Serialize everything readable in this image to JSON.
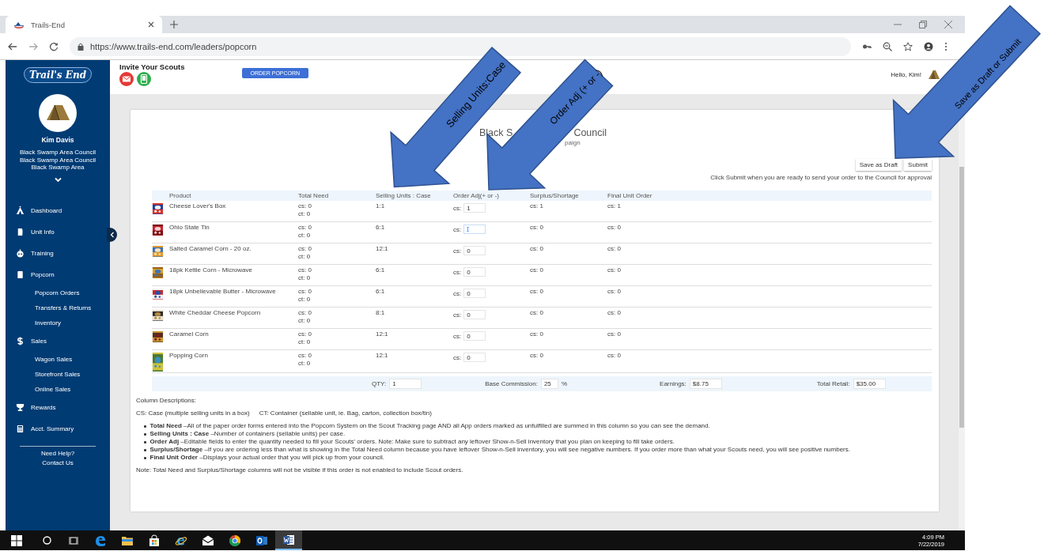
{
  "browser": {
    "tab_title": "Trails-End",
    "url": "https://www.trails-end.com/leaders/popcorn"
  },
  "sidebar": {
    "logo": "Trail's End",
    "user_name": "Kim Davis",
    "affiliations": [
      "Black Swamp Area Council",
      "Black Swamp Area Council",
      "Black Swamp Area"
    ],
    "nav": [
      {
        "label": "Dashboard"
      },
      {
        "label": "Unit Info"
      },
      {
        "label": "Training"
      },
      {
        "label": "Popcorn",
        "children": [
          "Popcorn Orders",
          "Transfers & Returns",
          "Inventory"
        ]
      },
      {
        "label": "Sales",
        "children": [
          "Wagon Sales",
          "Storefront Sales",
          "Online Sales"
        ]
      },
      {
        "label": "Rewards"
      },
      {
        "label": "Acct. Summary"
      }
    ],
    "help": [
      "Need Help?",
      "Contact Us"
    ]
  },
  "header": {
    "invite_title": "Invite Your Scouts",
    "order_button": "ORDER POPCORN",
    "greeting": "Hello, Kim!"
  },
  "order": {
    "title_parts": [
      "Black S",
      "Council"
    ],
    "subtitle_part": "paign",
    "buttons": [
      "Save as Draft",
      "Submit"
    ],
    "hint": "Click Submit when you are ready to send your order to the Council for approval"
  },
  "table": {
    "columns": [
      "Product",
      "Total Need",
      "Selling Units : Case",
      "Order Adj(+ or -)",
      "Surplus/Shortage",
      "Final Unit Order"
    ],
    "rows": [
      {
        "product": "Cheese Lover's Box",
        "total_need": [
          "cs: 0",
          "ct: 0"
        ],
        "selling_units": "1:1",
        "order_adj_label": "cs:",
        "order_adj": "1",
        "focused": false,
        "surplus": "cs: 1",
        "final": "cs: 1"
      },
      {
        "product": "Ohio State Tin",
        "total_need": [
          "cs: 0",
          "ct: 0"
        ],
        "selling_units": "6:1",
        "order_adj_label": "cs:",
        "focused": true,
        "surplus": "cs: 0",
        "final": "cs: 0"
      },
      {
        "product": "Salted Caramel Corn - 20 oz.",
        "total_need": [
          "cs: 0",
          "ct: 0"
        ],
        "selling_units": "12:1",
        "order_adj_label": "cs:",
        "order_adj": "0",
        "focused": false,
        "surplus": "cs: 0",
        "final": "cs: 0"
      },
      {
        "product": "18pk Kettle Corn - Microwave",
        "total_need": [
          "cs: 0",
          "ct: 0"
        ],
        "selling_units": "6:1",
        "order_adj_label": "cs:",
        "order_adj": "0",
        "focused": false,
        "surplus": "cs: 0",
        "final": "cs: 0"
      },
      {
        "product": "18pk Unbelievable Butter - Microwave",
        "total_need": [
          "cs: 0",
          "ct: 0"
        ],
        "selling_units": "6:1",
        "order_adj_label": "cs:",
        "order_adj": "0",
        "focused": false,
        "surplus": "cs: 0",
        "final": "cs: 0"
      },
      {
        "product": "White Cheddar Cheese Popcorn",
        "total_need": [
          "cs: 0",
          "ct: 0"
        ],
        "selling_units": "8:1",
        "order_adj_label": "cs:",
        "order_adj": "0",
        "focused": false,
        "surplus": "cs: 0",
        "final": "cs: 0"
      },
      {
        "product": "Caramel Corn",
        "total_need": [
          "cs: 0",
          "ct: 0"
        ],
        "selling_units": "12:1",
        "order_adj_label": "cs:",
        "order_adj": "0",
        "focused": false,
        "surplus": "cs: 0",
        "final": "cs: 0"
      },
      {
        "product": "Popping Corn",
        "total_need": [
          "cs: 0",
          "ct: 0"
        ],
        "selling_units": "12:1",
        "order_adj_label": "cs:",
        "order_adj": "0",
        "focused": false,
        "surplus": "cs: 0",
        "final": "cs: 0"
      }
    ]
  },
  "totals": [
    {
      "label": "QTY:",
      "value": "1"
    },
    {
      "label": "Base Commission:",
      "value": "25",
      "suffix": "%"
    },
    {
      "label": "Earnings:",
      "value": "$8.75"
    },
    {
      "label": "Total Retail:",
      "value": "$35.00"
    }
  ],
  "descriptions": {
    "heading": "Column Descriptions:",
    "legend": [
      "CS: Case (multiple selling units in a box)",
      "CT: Container (sellable unit, ie. Bag, carton, collection box/tin)"
    ],
    "items": [
      "**Total Need** –All of the paper order forms entered into the Popcorn System on the Scout Tracking page AND all App orders marked as unfulfilled are summed in this column so you can see the demand.",
      "**Selling Units : Case** –Number of containers (sellable units) per case.",
      "**Order Adj** –Editable fields to enter the quantity needed to fill your Scouts' orders. Note: Make sure to subtract any leftover Show-n-Sell inventory that you plan on keeping to fill take orders.",
      "**Surplus/Shortage** –If you are ordering less than what is showing in the Total Need column because you have leftover Show-n-Sell inventory, you will see negative numbers. If you order more than what your Scouts need, you will see positive numbers.",
      "**Final Unit Order** –Displays your actual order that you will pick up from your council."
    ],
    "note": "Note: Total Need and Surplus/Shortage columns will not be visible if this order is not enabled to include Scout orders."
  },
  "callouts": [
    {
      "text": "Selling Units:Case"
    },
    {
      "text": "Order Adj (+ or -)"
    },
    {
      "text": "Save as Draft or Submit"
    }
  ],
  "taskbar": {
    "apps": [
      {
        "selected": false
      },
      {
        "selected": false
      },
      {
        "selected": false
      },
      {
        "selected": false
      },
      {
        "selected": false
      },
      {
        "selected": false
      },
      {
        "selected": false
      },
      {
        "selected": true
      }
    ],
    "time": "4:09 PM",
    "date": "7/22/2019"
  }
}
